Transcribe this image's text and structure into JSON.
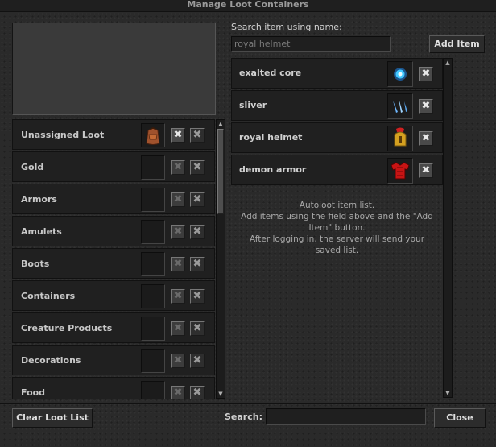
{
  "window": {
    "title": "Manage Loot Containers"
  },
  "categories": [
    {
      "label": "Unassigned Loot",
      "icon": "backpack-icon",
      "has_item": true
    },
    {
      "label": "Gold",
      "icon": "",
      "has_item": false
    },
    {
      "label": "Armors",
      "icon": "",
      "has_item": false
    },
    {
      "label": "Amulets",
      "icon": "",
      "has_item": false
    },
    {
      "label": "Boots",
      "icon": "",
      "has_item": false
    },
    {
      "label": "Containers",
      "icon": "",
      "has_item": false
    },
    {
      "label": "Creature Products",
      "icon": "",
      "has_item": false
    },
    {
      "label": "Decorations",
      "icon": "",
      "has_item": false
    },
    {
      "label": "Food",
      "icon": "",
      "has_item": false
    }
  ],
  "search": {
    "label": "Search item using name:",
    "value": "royal helmet",
    "add_button": "Add Item"
  },
  "items": [
    {
      "label": "exalted core",
      "icon": "exalted-core-icon"
    },
    {
      "label": "sliver",
      "icon": "sliver-icon"
    },
    {
      "label": "royal helmet",
      "icon": "royal-helmet-icon"
    },
    {
      "label": "demon armor",
      "icon": "demon-armor-icon"
    }
  ],
  "info": {
    "line1": "Autoloot item list.",
    "line2": "Add items using the field above and the \"Add",
    "line3": "Item\" button.",
    "line4": "After logging in, the server will send your",
    "line5": "saved list."
  },
  "footer": {
    "clear_button": "Clear Loot List",
    "search_label": "Search:",
    "search_value": "",
    "close_button": "Close"
  },
  "symbols": {
    "remove": "✖"
  }
}
